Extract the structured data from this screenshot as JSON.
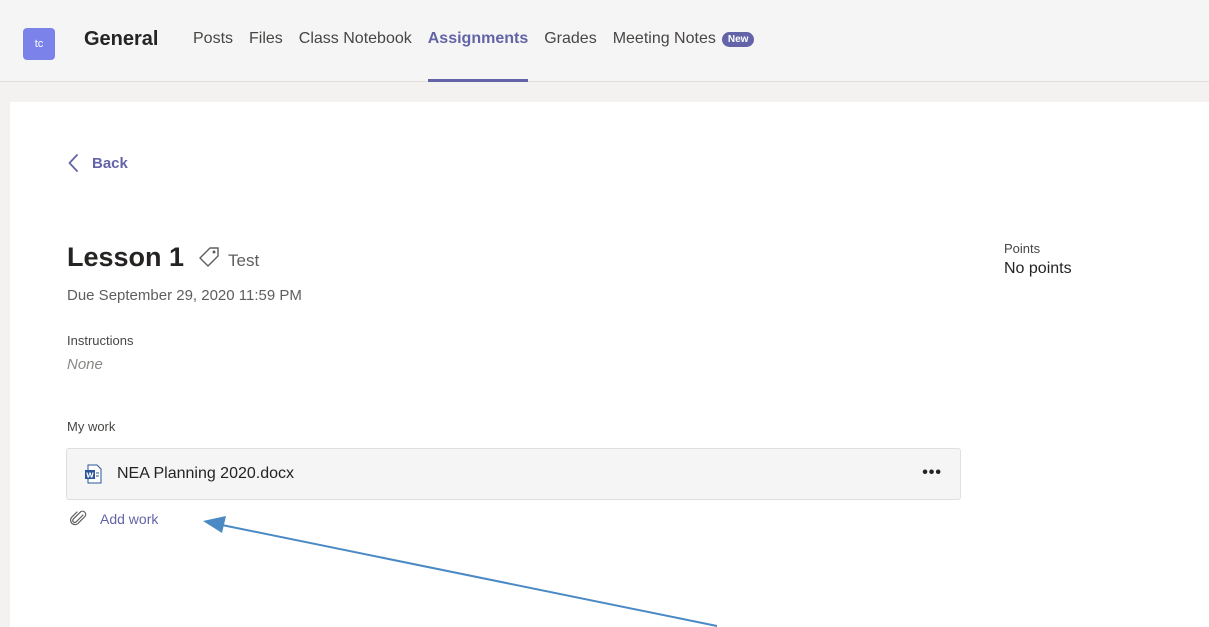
{
  "header": {
    "team_initials": "tc",
    "channel": "General",
    "tabs": [
      {
        "label": "Posts"
      },
      {
        "label": "Files"
      },
      {
        "label": "Class Notebook"
      },
      {
        "label": "Assignments"
      },
      {
        "label": "Grades"
      },
      {
        "label": "Meeting Notes"
      }
    ],
    "active_tab": "Assignments",
    "new_badge": "New"
  },
  "assignment": {
    "back_label": "Back",
    "title": "Lesson 1",
    "tag": "Test",
    "due": "Due September 29, 2020 11:59 PM",
    "instructions_label": "Instructions",
    "instructions_value": "None",
    "my_work_label": "My work",
    "file_name": "NEA Planning 2020.docx",
    "more_label": "•••",
    "add_work_label": "Add work",
    "points_label": "Points",
    "points_value": "No points"
  },
  "colors": {
    "accent": "#6264a7",
    "avatar": "#7b83eb",
    "arrow": "#4a89c4"
  },
  "icons": {
    "back": "chevron-left-icon",
    "tag": "tag-icon",
    "file": "word-document-icon",
    "add": "paperclip-icon",
    "annotation": "arrow-annotation"
  }
}
